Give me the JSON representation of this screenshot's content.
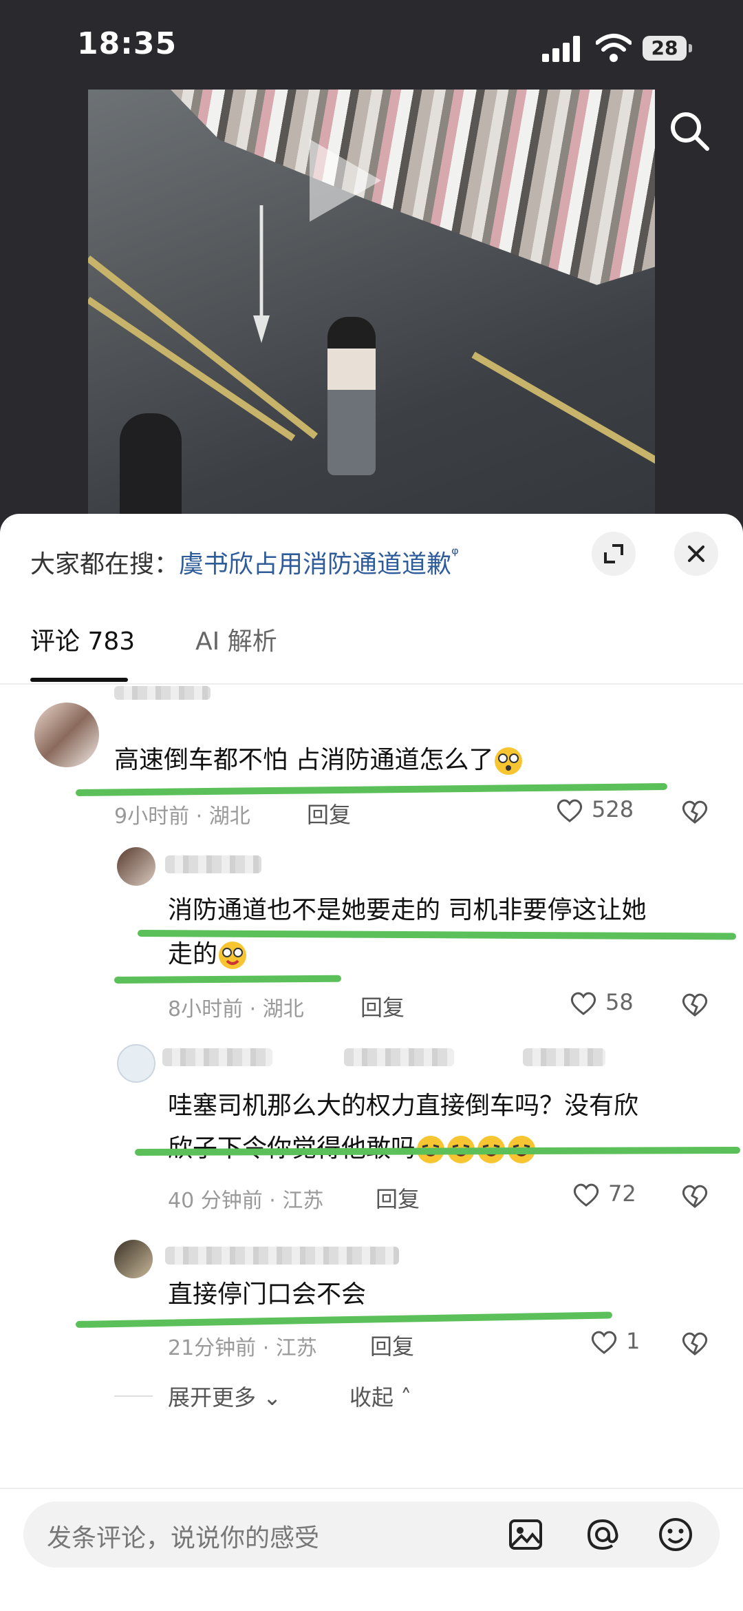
{
  "status_bar": {
    "time": "18:35",
    "battery": "28"
  },
  "panel": {
    "hot_search_prefix": "大家都在搜：",
    "hot_search_link": "虞书欣占用消防通道道歉",
    "tabs": [
      {
        "label": "评论 783"
      },
      {
        "label": "AI 解析"
      }
    ]
  },
  "comments": [
    {
      "text": "高速倒车都不怕 占消防通道怎么了",
      "meta": "9小时前 · 湖北",
      "reply": "回复",
      "likes": "528"
    },
    {
      "text_line1": "消防通道也不是她要走的 司机非要停这让她",
      "text_line2": "走的",
      "meta": "8小时前 · 湖北",
      "reply": "回复",
      "likes": "58"
    },
    {
      "text_line1": "哇塞司机那么大的权力直接倒车吗？没有欣",
      "text_line2": "欣子下令你觉得他敢吗",
      "meta": "40 分钟前 · 江苏",
      "reply": "回复",
      "likes": "72"
    },
    {
      "text": "直接停门口会不会",
      "meta": "21分钟前 · 江苏",
      "reply": "回复",
      "likes": "1"
    }
  ],
  "thread_controls": {
    "expand": "展开更多",
    "collapse": "收起"
  },
  "composer": {
    "placeholder": "发条评论，说说你的感受"
  },
  "colors": {
    "highlight": "#5cc05a",
    "link": "#2e5b9a"
  }
}
